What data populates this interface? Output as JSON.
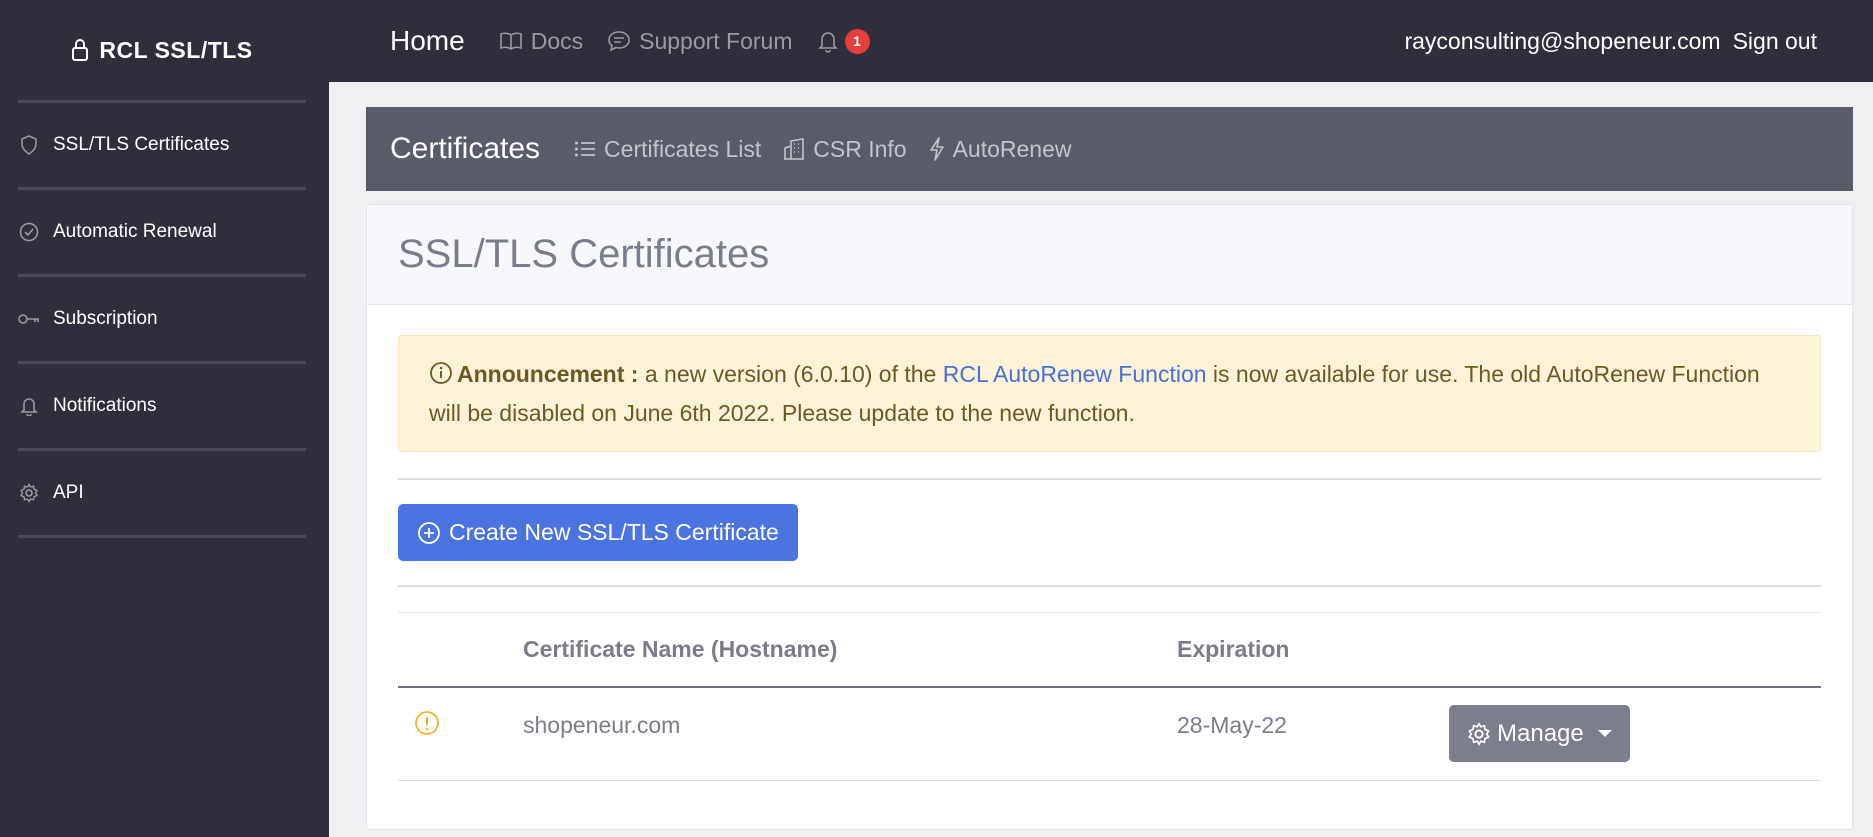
{
  "brand": {
    "title": "RCL SSL/TLS",
    "icon": "lock-icon"
  },
  "sidebar": {
    "items": [
      {
        "label": "SSL/TLS Certificates",
        "icon": "shield-icon"
      },
      {
        "label": "Automatic Renewal",
        "icon": "check-circle-icon"
      },
      {
        "label": "Subscription",
        "icon": "key-icon"
      },
      {
        "label": "Notifications",
        "icon": "bell-icon"
      },
      {
        "label": "API",
        "icon": "gear-icon"
      }
    ]
  },
  "topbar": {
    "home": "Home",
    "docs": "Docs",
    "support": "Support Forum",
    "notification_count": "1",
    "email": "rayconsulting@shopeneur.com",
    "signout": "Sign out"
  },
  "subheader": {
    "title": "Certificates",
    "links": [
      "Certificates List",
      "CSR Info",
      "AutoRenew"
    ]
  },
  "card": {
    "title": "SSL/TLS Certificates",
    "announcement": {
      "label": "Announcement :",
      "text_before": " a new version (6.0.10) of the ",
      "link": "RCL AutoRenew Function",
      "text_after": " is now available for use. The old AutoRenew Function will be disabled on June 6th 2022. Please update to the new function."
    },
    "create_button": "Create New SSL/TLS Certificate",
    "table": {
      "headers": [
        "",
        "Certificate Name (Hostname)",
        "Expiration",
        ""
      ],
      "rows": [
        {
          "status_icon": "warning-circle-icon",
          "name": "shopeneur.com",
          "expiration": "28-May-22",
          "action": "Manage"
        }
      ]
    }
  },
  "colors": {
    "sidebar_bg": "#2f2f3b",
    "subheader_bg": "#5a5b69",
    "primary": "#4a74e0",
    "warning": "#f0b429",
    "badge": "#e43f3a",
    "alert_bg": "#fdf3d8"
  }
}
